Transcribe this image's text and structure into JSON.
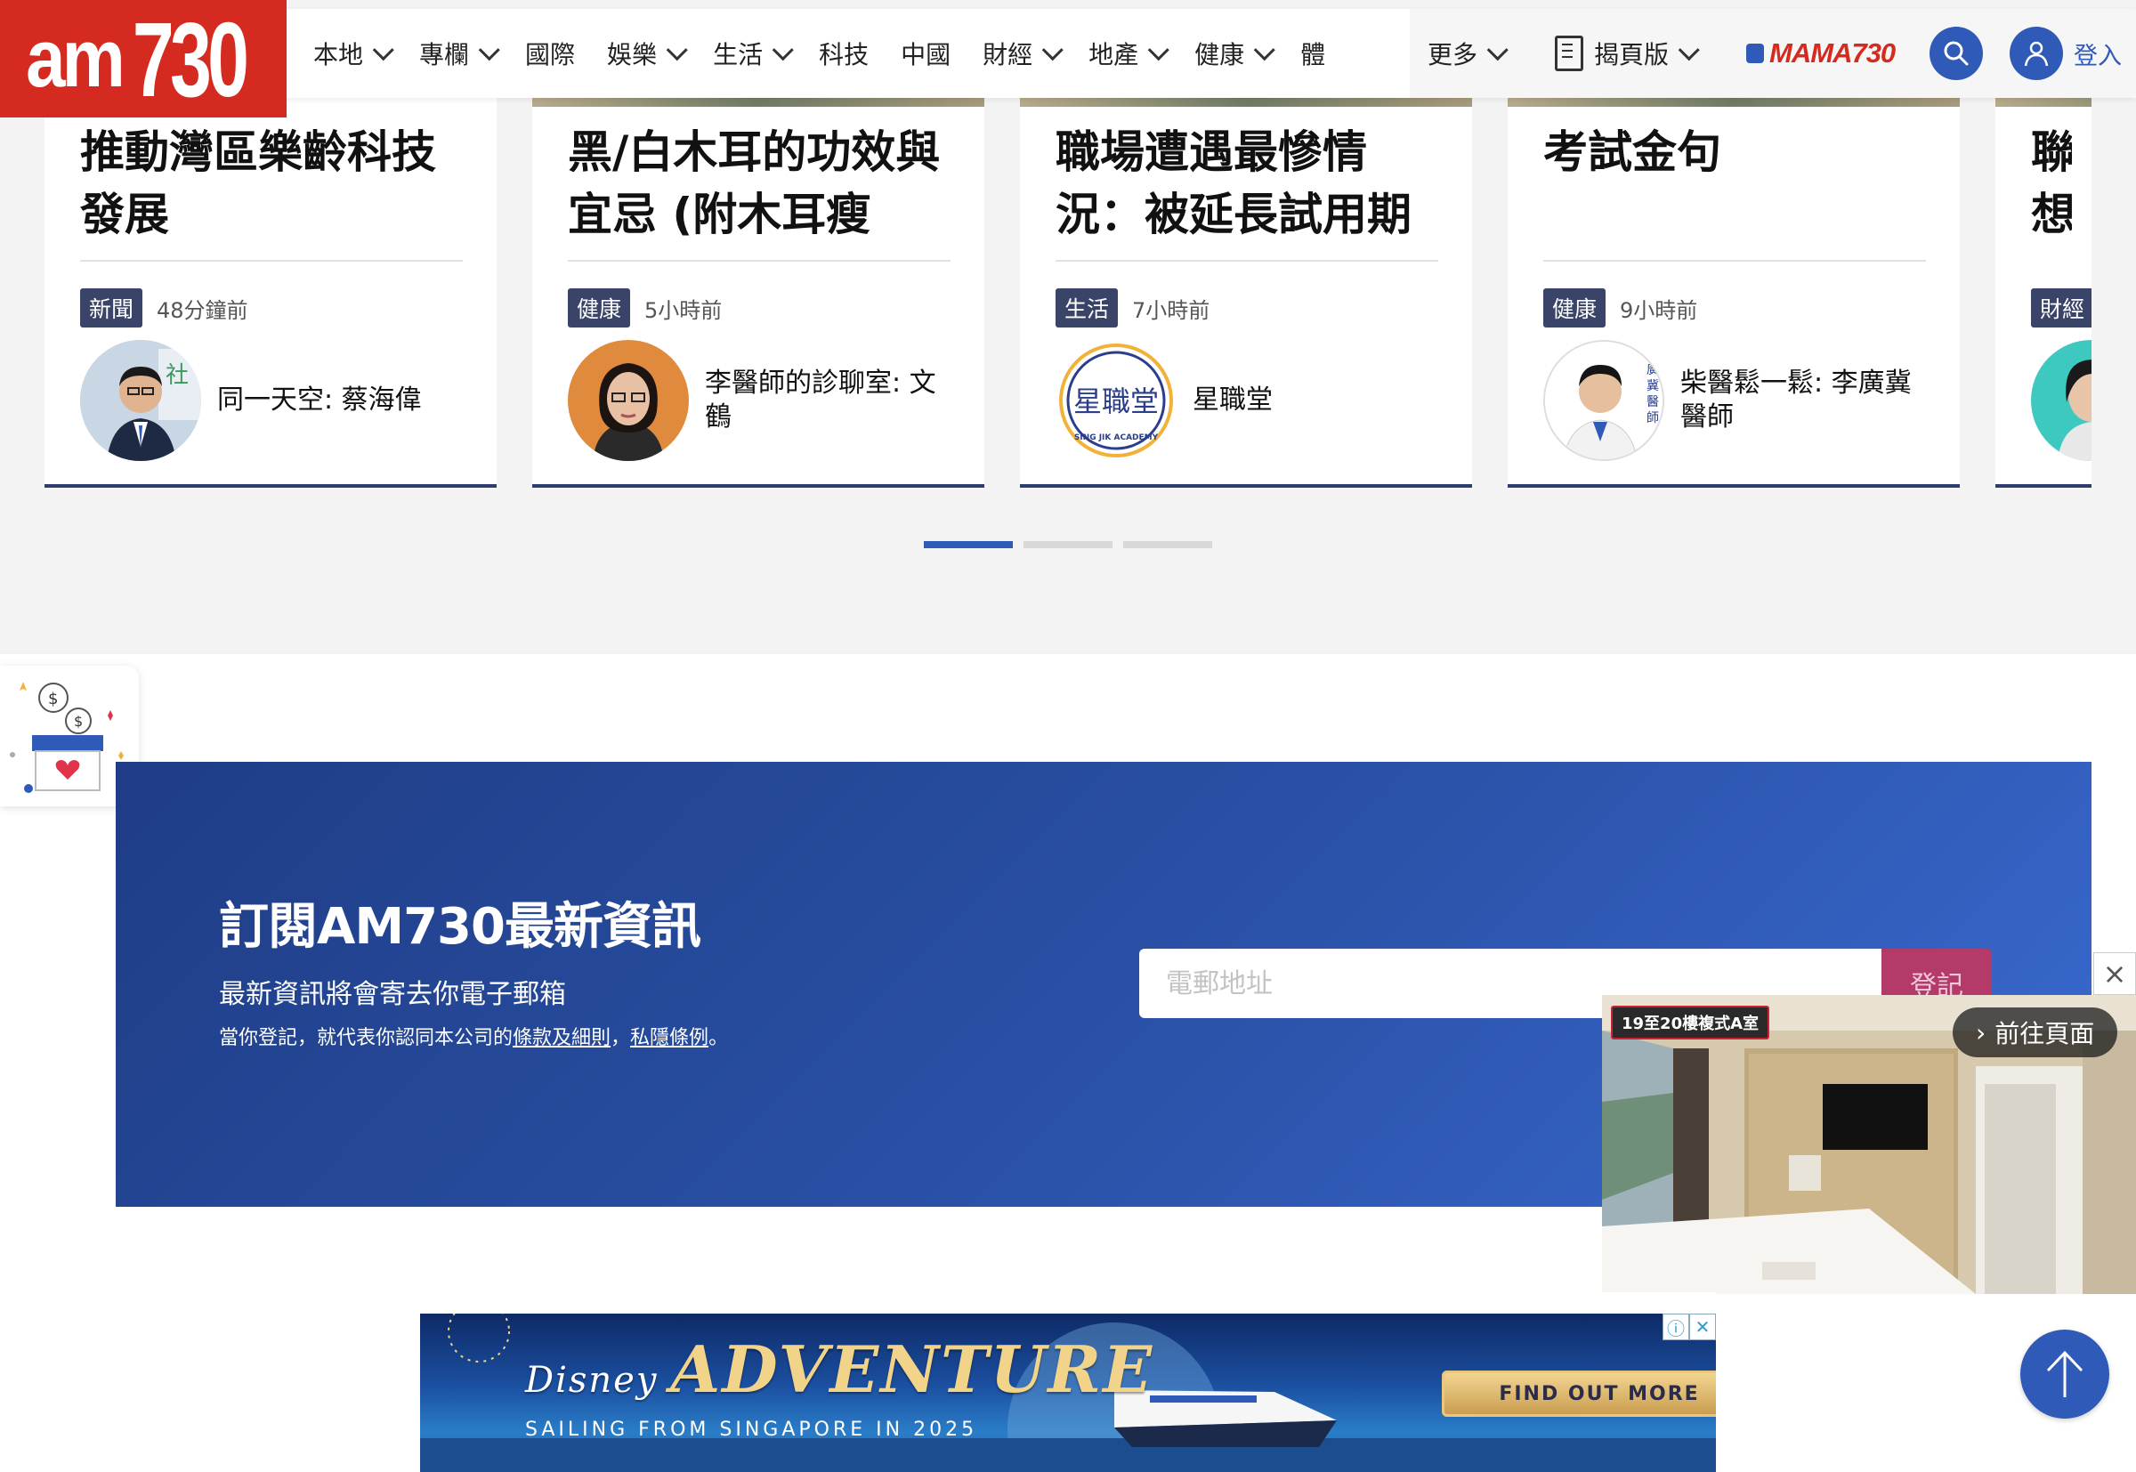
{
  "brand": {
    "logo": "am730"
  },
  "nav": {
    "items": [
      {
        "label": "本地",
        "has_dropdown": true
      },
      {
        "label": "專欄",
        "has_dropdown": true
      },
      {
        "label": "國際",
        "has_dropdown": false
      },
      {
        "label": "娛樂",
        "has_dropdown": true
      },
      {
        "label": "生活",
        "has_dropdown": true
      },
      {
        "label": "科技",
        "has_dropdown": false
      },
      {
        "label": "中國",
        "has_dropdown": false
      },
      {
        "label": "財經",
        "has_dropdown": true
      },
      {
        "label": "地產",
        "has_dropdown": true
      },
      {
        "label": "健康",
        "has_dropdown": true
      },
      {
        "label": "體",
        "has_dropdown": false
      }
    ],
    "more": "更多",
    "epaper": "揭頁版",
    "mama": "MAMA730",
    "login": "登入"
  },
  "cards": [
    {
      "title": "推動灣區樂齡科技發展",
      "tag": "新聞",
      "time": "48分鐘前",
      "author": "同一天空: 蔡海偉"
    },
    {
      "title": "黑/白木耳的功效與宜忌 (附木耳瘦",
      "tag": "健康",
      "time": "5小時前",
      "author": "李醫師的診聊室: 文鶴"
    },
    {
      "title": "職場遭遇最慘情況：被延長試用期",
      "tag": "生活",
      "time": "7小時前",
      "author": "星職堂"
    },
    {
      "title": "考試金句",
      "tag": "健康",
      "time": "9小時前",
      "author": "柴醫鬆一鬆: 李廣冀醫師"
    },
    {
      "title": "聯想中東",
      "tag": "財經",
      "time": "",
      "author": ""
    }
  ],
  "subscribe": {
    "title": "訂閱AM730最新資訊",
    "desc": "最新資訊將會寄去你電子郵箱",
    "note_prefix": "當你登記，就代表你認同本公司的",
    "terms": "條款及細則",
    "sep": "，",
    "privacy": "私隱條例",
    "note_suffix": "。",
    "email_placeholder": "電郵地址",
    "button": "登記"
  },
  "video": {
    "room_label": "19至20樓複式A室",
    "goto": "前往頁面"
  },
  "ad": {
    "brand": "ADVENTURE",
    "brand_prefix": "Disney",
    "tagline": "SAILING FROM SINGAPORE IN 2025",
    "cta": "FIND OUT MORE"
  },
  "colors": {
    "accent": "#2f5ab8",
    "logo_red": "#d42a1f",
    "tag_bg": "#3a4468"
  }
}
